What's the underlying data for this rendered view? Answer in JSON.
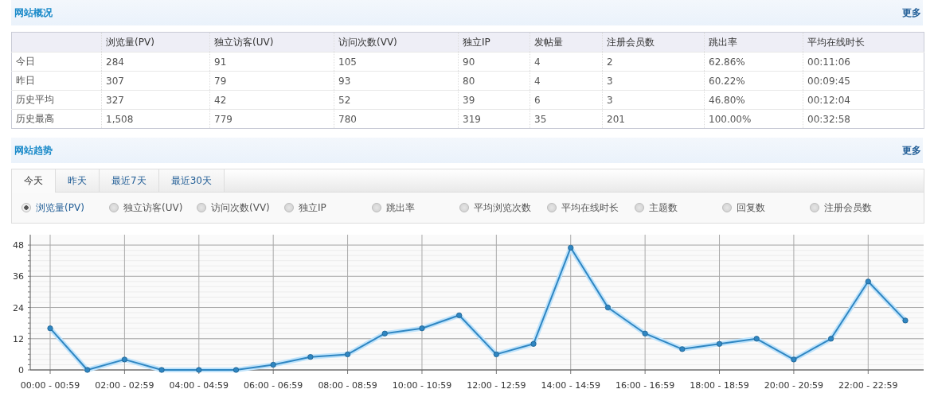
{
  "overview": {
    "title": "网站概况",
    "more": "更多",
    "columns": [
      "",
      "浏览量(PV)",
      "独立访客(UV)",
      "访问次数(VV)",
      "独立IP",
      "发帖量",
      "注册会员数",
      "跳出率",
      "平均在线时长"
    ],
    "rows": [
      [
        "今日",
        "284",
        "91",
        "105",
        "90",
        "4",
        "2",
        "62.86%",
        "00:11:06"
      ],
      [
        "昨日",
        "307",
        "79",
        "93",
        "80",
        "4",
        "3",
        "60.22%",
        "00:09:45"
      ],
      [
        "历史平均",
        "327",
        "42",
        "52",
        "39",
        "6",
        "3",
        "46.80%",
        "00:12:04"
      ],
      [
        "历史最高",
        "1,508",
        "779",
        "780",
        "319",
        "35",
        "201",
        "100.00%",
        "00:32:58"
      ]
    ]
  },
  "trend": {
    "title": "网站趋势",
    "more": "更多",
    "tabs": [
      {
        "label": "今天",
        "selected": true
      },
      {
        "label": "昨天",
        "selected": false
      },
      {
        "label": "最近7天",
        "selected": false
      },
      {
        "label": "最近30天",
        "selected": false
      }
    ],
    "metrics": [
      {
        "label": "浏览量(PV)",
        "selected": true
      },
      {
        "label": "独立访客(UV)",
        "selected": false
      },
      {
        "label": "访问次数(VV)",
        "selected": false
      },
      {
        "label": "独立IP",
        "selected": false
      },
      {
        "label": "跳出率",
        "selected": false
      },
      {
        "label": "平均浏览次数",
        "selected": false
      },
      {
        "label": "平均在线时长",
        "selected": false
      },
      {
        "label": "主题数",
        "selected": false
      },
      {
        "label": "回复数",
        "selected": false
      },
      {
        "label": "注册会员数",
        "selected": false
      }
    ],
    "chart_data": {
      "type": "line",
      "categories": [
        "00:00 - 00:59",
        null,
        "02:00 - 02:59",
        null,
        "04:00 - 04:59",
        null,
        "06:00 - 06:59",
        null,
        "08:00 - 08:59",
        null,
        "10:00 - 10:59",
        null,
        "12:00 - 12:59",
        null,
        "14:00 - 14:59",
        null,
        "16:00 - 16:59",
        null,
        "18:00 - 18:59",
        null,
        "20:00 - 20:59",
        null,
        "22:00 - 22:59",
        null
      ],
      "series": [
        {
          "color": "#2f86c2",
          "marker": "circle",
          "values": [
            16,
            0,
            4,
            0,
            0,
            0,
            2,
            5,
            6,
            14,
            16,
            21,
            6,
            10,
            47,
            24,
            14,
            8,
            10,
            12,
            4,
            12,
            34,
            19
          ]
        }
      ],
      "ylim": [
        0,
        52
      ],
      "yticks": [
        0,
        12,
        24,
        36,
        48
      ],
      "grid": true
    }
  }
}
